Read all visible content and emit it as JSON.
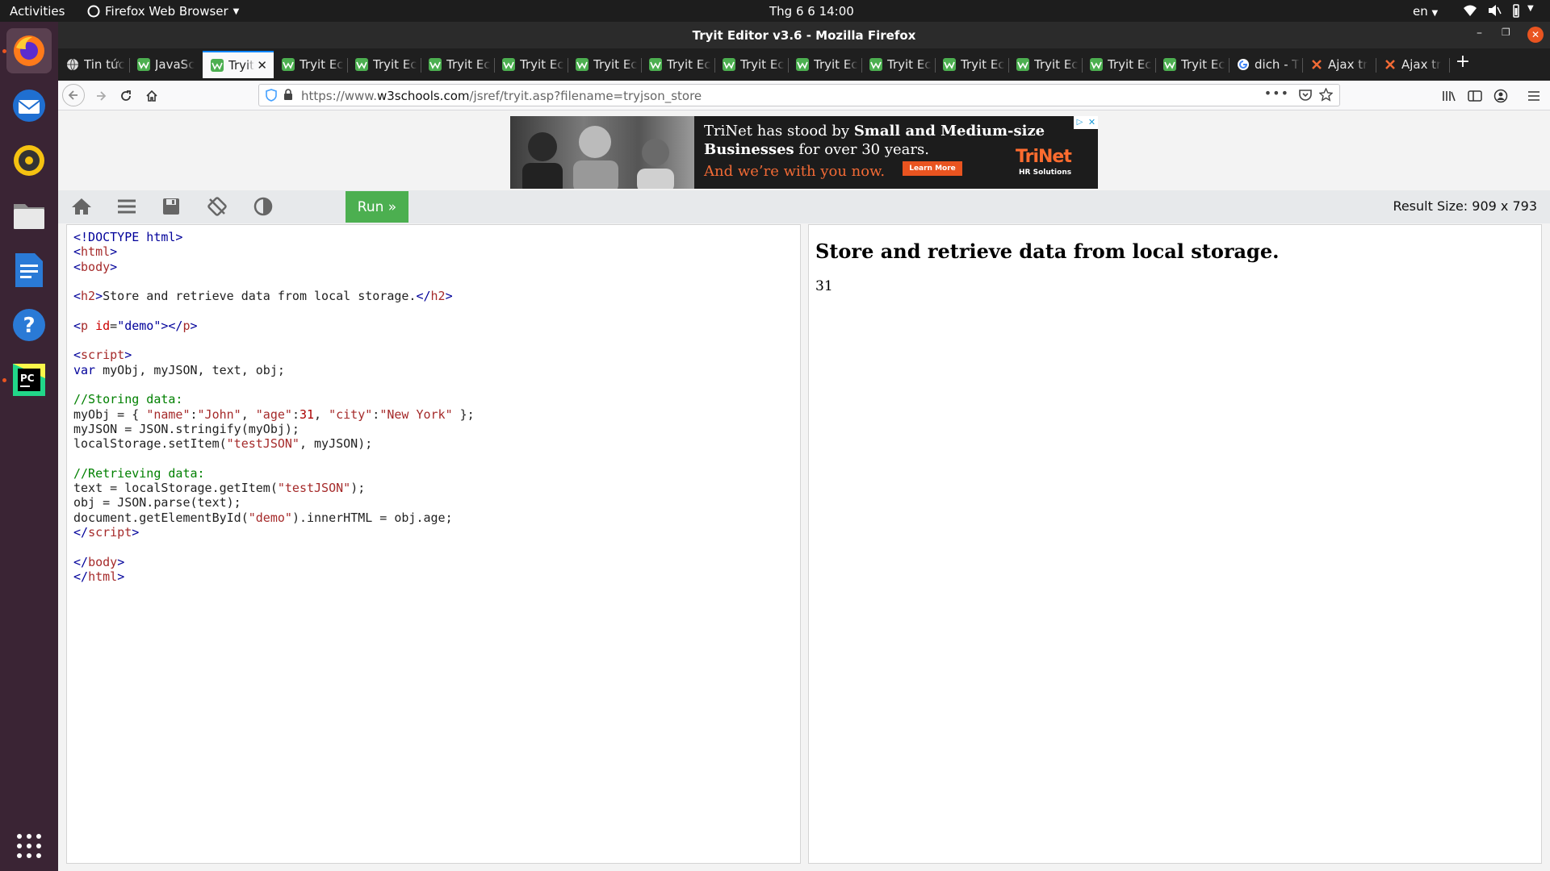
{
  "topbar": {
    "activities": "Activities",
    "app_menu": "Firefox Web Browser",
    "clock": "Thg 6 6  14:00",
    "lang": "en"
  },
  "window": {
    "title": "Tryit Editor v3.6 - Mozilla Firefox"
  },
  "tabs": [
    {
      "label": "Tin tức",
      "icon": "globe-icon"
    },
    {
      "label": "JavaSc",
      "icon": "w3schools-icon"
    },
    {
      "label": "Tryit",
      "icon": "w3schools-icon",
      "active": true
    },
    {
      "label": "Tryit Ec",
      "icon": "w3schools-icon"
    },
    {
      "label": "Tryit Ec",
      "icon": "w3schools-icon"
    },
    {
      "label": "Tryit Ec",
      "icon": "w3schools-icon"
    },
    {
      "label": "Tryit Ec",
      "icon": "w3schools-icon"
    },
    {
      "label": "Tryit Ec",
      "icon": "w3schools-icon"
    },
    {
      "label": "Tryit Ec",
      "icon": "w3schools-icon"
    },
    {
      "label": "Tryit Ec",
      "icon": "w3schools-icon"
    },
    {
      "label": "Tryit Ec",
      "icon": "w3schools-icon"
    },
    {
      "label": "Tryit Ec",
      "icon": "w3schools-icon"
    },
    {
      "label": "Tryit Ec",
      "icon": "w3schools-icon"
    },
    {
      "label": "Tryit Ec",
      "icon": "w3schools-icon"
    },
    {
      "label": "Tryit Ec",
      "icon": "w3schools-icon"
    },
    {
      "label": "Tryit Ec",
      "icon": "w3schools-icon"
    },
    {
      "label": "dich - T",
      "icon": "google-icon"
    },
    {
      "label": "Ajax tr",
      "icon": "ajax-icon"
    },
    {
      "label": "Ajax tr",
      "icon": "ajax-icon"
    }
  ],
  "url": {
    "prefix": "https://www.",
    "domain": "w3schools.com",
    "path": "/jsref/tryit.asp?filename=tryjson_store"
  },
  "ad": {
    "line1a": "TriNet has stood by ",
    "line1b": "Small and Medium-size",
    "line2a": "Businesses",
    "line2b": " for over 30 years.",
    "line3": "And we’re with you now.",
    "cta": "Learn More",
    "brand": "TriNet",
    "brand_sub": "HR Solutions"
  },
  "toolbar": {
    "run_label": "Run »",
    "result_size": "Result Size: 909  x  793"
  },
  "result": {
    "heading": "Store and retrieve data from local storage.",
    "output": "31"
  },
  "colors": {
    "run_green": "#4caf50",
    "dock_bg": "#3a2434",
    "ubuntu_orange": "#e95420"
  }
}
